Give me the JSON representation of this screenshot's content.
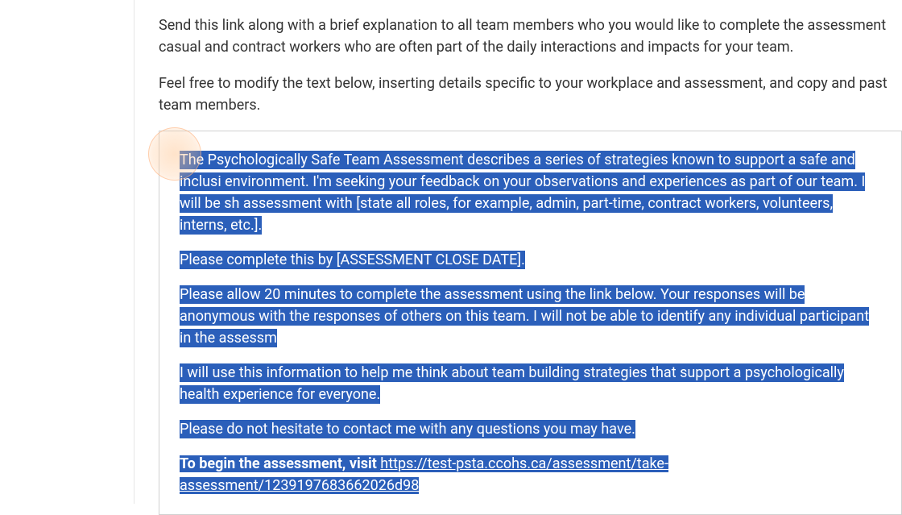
{
  "intro": {
    "para1": "Send this link along with a brief explanation to all team members who you would like to complete the assessment casual and contract workers who are often part of the daily interactions and impacts for your team.",
    "para2": "Feel free to modify the text below, inserting details specific to your workplace and assessment, and copy and past team members."
  },
  "message": {
    "p1": "The Psychologically Safe Team Assessment describes a series of strategies known to support a safe and inclusi environment. I'm seeking your feedback on your observations and experiences as part of our team. I will be sh assessment with [state all roles, for example, admin, part-time, contract workers, volunteers, interns, etc.].",
    "p2": "Please complete this by [ASSESSMENT CLOSE DATE].",
    "p3": "Please allow 20 minutes to complete the assessment using the link below. Your responses will be anonymous with the responses of others on this team. I will not be able to identify any individual participant in the assessm",
    "p4": "I will use this information to help me think about team building strategies that support a psychologically health experience for everyone.",
    "p5": "Please do not hesitate to contact me with any questions you may have.",
    "p6_bold": "To begin the assessment, visit ",
    "p6_link": "https://test-psta.ccohs.ca/assessment/take-assessment/1239197683662026d98"
  }
}
